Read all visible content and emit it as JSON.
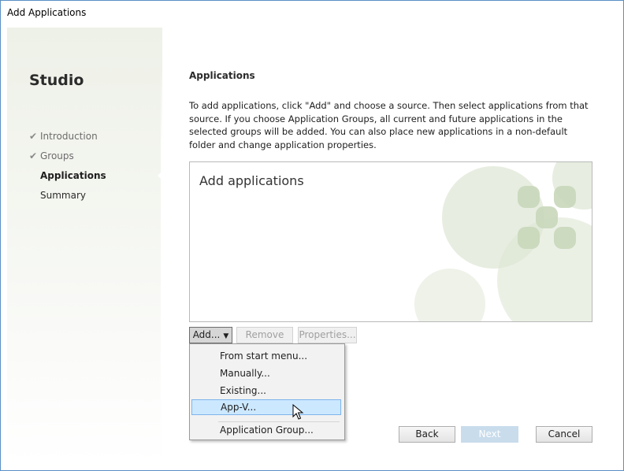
{
  "window": {
    "title": "Add Applications"
  },
  "sidebar": {
    "brand": "Studio",
    "steps": [
      {
        "label": "Introduction",
        "state": "done"
      },
      {
        "label": "Groups",
        "state": "done"
      },
      {
        "label": "Applications",
        "state": "current"
      },
      {
        "label": "Summary",
        "state": "pending"
      }
    ]
  },
  "main": {
    "title": "Applications",
    "description": "To add applications, click \"Add\" and choose a source. Then select applications from that source. If you choose Application Groups, all current and future applications in the selected groups will be added. You can also place new applications in a non-default folder and change application properties.",
    "list_heading": "Add applications"
  },
  "toolbar": {
    "add_label": "Add...",
    "remove_label": "Remove",
    "properties_label": "Properties..."
  },
  "add_menu": {
    "items": [
      {
        "label": "From start menu..."
      },
      {
        "label": "Manually..."
      },
      {
        "label": "Existing..."
      },
      {
        "label": "App-V..."
      },
      {
        "label": "Application Group..."
      }
    ],
    "highlighted": "App-V..."
  },
  "footer": {
    "back_label": "Back",
    "next_label": "Next",
    "cancel_label": "Cancel"
  },
  "icons": {
    "check": "check-icon",
    "dropdown": "caret-down-icon",
    "cursor": "mouse-pointer-icon"
  },
  "colors": {
    "accent_highlight": "#cce8ff",
    "next_disabled": "#c8dcec",
    "art_green": "#d4dfc8"
  }
}
